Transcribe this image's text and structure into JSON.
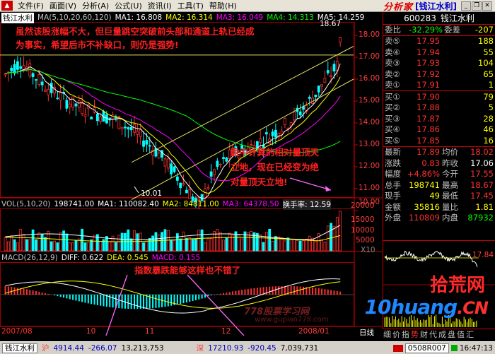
{
  "menu": {
    "items": [
      "文件(F)",
      "画面(V)",
      "分析(A)",
      "公式(U)",
      "资讯(I)",
      "工具(T)",
      "帮助(H)"
    ],
    "brand": "分析家",
    "brand_stock": "[钱江水利]"
  },
  "chart_header": {
    "stock_name": "钱江水利",
    "ma_label": "MA(5,10,20,60,120)",
    "ma1": "MA1: 16.808",
    "ma2": "MA2: 16.314",
    "ma3": "MA3: 16.049",
    "ma4": "MA4: 14.313",
    "ma5": "MA5: 14.259"
  },
  "price_axis": [
    "18.00",
    "17.00",
    "16.00",
    "15.00",
    "14.00",
    "13.00",
    "12.00",
    "11.00",
    "10.00"
  ],
  "price_marks": {
    "high": "18.67",
    "low": "10.01"
  },
  "vol_header": {
    "label": "VOL(5,10,20)",
    "vol": "198741.00",
    "ma1": "MA1: 110082.40",
    "ma2": "MA2: 84811.00",
    "ma3": "MA3: 64378.50",
    "turnover": "换手率: 12.59"
  },
  "vol_axis": [
    "20000",
    "15000",
    "10000",
    "5000"
  ],
  "vol_unit": "X10",
  "macd_header": {
    "label": "MACD(26,12,9)",
    "diff": "DIFF: 0.622",
    "dea": "DEA: 0.545",
    "macd": "MACD: 0.155"
  },
  "date_axis": [
    "2007/08",
    "10",
    "11",
    "12",
    "2008/01"
  ],
  "date_axis_right": "日线",
  "annotations": {
    "top1": "虽然该股涨幅不大，但巨量跳空突破前头部和通道上轨已经成",
    "top2": "为事实，希望后市不补缺口，则仍是强势!",
    "mid1": "盘中计算的相对量顶天",
    "mid2": "立地，现在已经变为绝",
    "mid3": "对量顶天立地!",
    "macd": "指数暴跌能够这样也不错了"
  },
  "watermark": {
    "line1": "778股票学习网",
    "line2": "www.gupiao778.com"
  },
  "site_logo": {
    "cn": "拾荒网",
    "en": "10huang",
    "dom": ".CN"
  },
  "info": {
    "code": "600283",
    "name": "钱江水利",
    "weibi_label": "委比",
    "weibi": "-32.29%",
    "weicha_label": "委差",
    "weicha": "-207",
    "sell": [
      {
        "label": "卖⑤",
        "price": "17.95",
        "vol": "188"
      },
      {
        "label": "卖④",
        "price": "17.94",
        "vol": "55"
      },
      {
        "label": "卖③",
        "price": "17.93",
        "vol": "104"
      },
      {
        "label": "卖②",
        "price": "17.92",
        "vol": "65"
      },
      {
        "label": "卖①",
        "price": "17.91",
        "vol": "1"
      }
    ],
    "buy": [
      {
        "label": "买①",
        "price": "17.90",
        "vol": "79"
      },
      {
        "label": "买②",
        "price": "17.88",
        "vol": "5"
      },
      {
        "label": "买③",
        "price": "17.87",
        "vol": "28"
      },
      {
        "label": "买④",
        "price": "17.86",
        "vol": "46"
      },
      {
        "label": "买⑤",
        "price": "17.85",
        "vol": "16"
      }
    ],
    "stats": [
      {
        "l1": "最新",
        "v1": "17.89",
        "l2": "均价",
        "v2": "18.02"
      },
      {
        "l1": "涨跌",
        "v1": "0.83",
        "l2": "昨收",
        "v2": "17.06"
      },
      {
        "l1": "幅度",
        "v1": "+4.86%",
        "l2": "今开",
        "v2": "17.55"
      },
      {
        "l1": "总手",
        "v1": "198741",
        "l2": "最高",
        "v2": "18.67"
      },
      {
        "l1": "现手",
        "v1": "49",
        "l2": "最低",
        "v2": "17.45"
      },
      {
        "l1": "金额",
        "v1": "35816",
        "l2": "量比",
        "v2": "1.81"
      },
      {
        "l1": "外盘",
        "v1": "110809",
        "l2": "内盘",
        "v2": "87932"
      }
    ]
  },
  "mini": {
    "price_hi": "17.84",
    "price_lo": "17.06"
  },
  "bottom_tabs": [
    "细",
    "价",
    "指",
    "势",
    "财",
    "代",
    "成",
    "盘",
    "值",
    "汇"
  ],
  "status": {
    "tab": "钱江水利",
    "sh_label": "沪",
    "sh_index": "4914.44",
    "sh_change": "-266.07",
    "sh_amount": "13,213,753",
    "sz_label": "深",
    "sz_index": "17210.93",
    "sz_change": "-920.45",
    "sz_amount": "7,039,731",
    "date": "0508R007",
    "time": "16:47:13"
  }
}
